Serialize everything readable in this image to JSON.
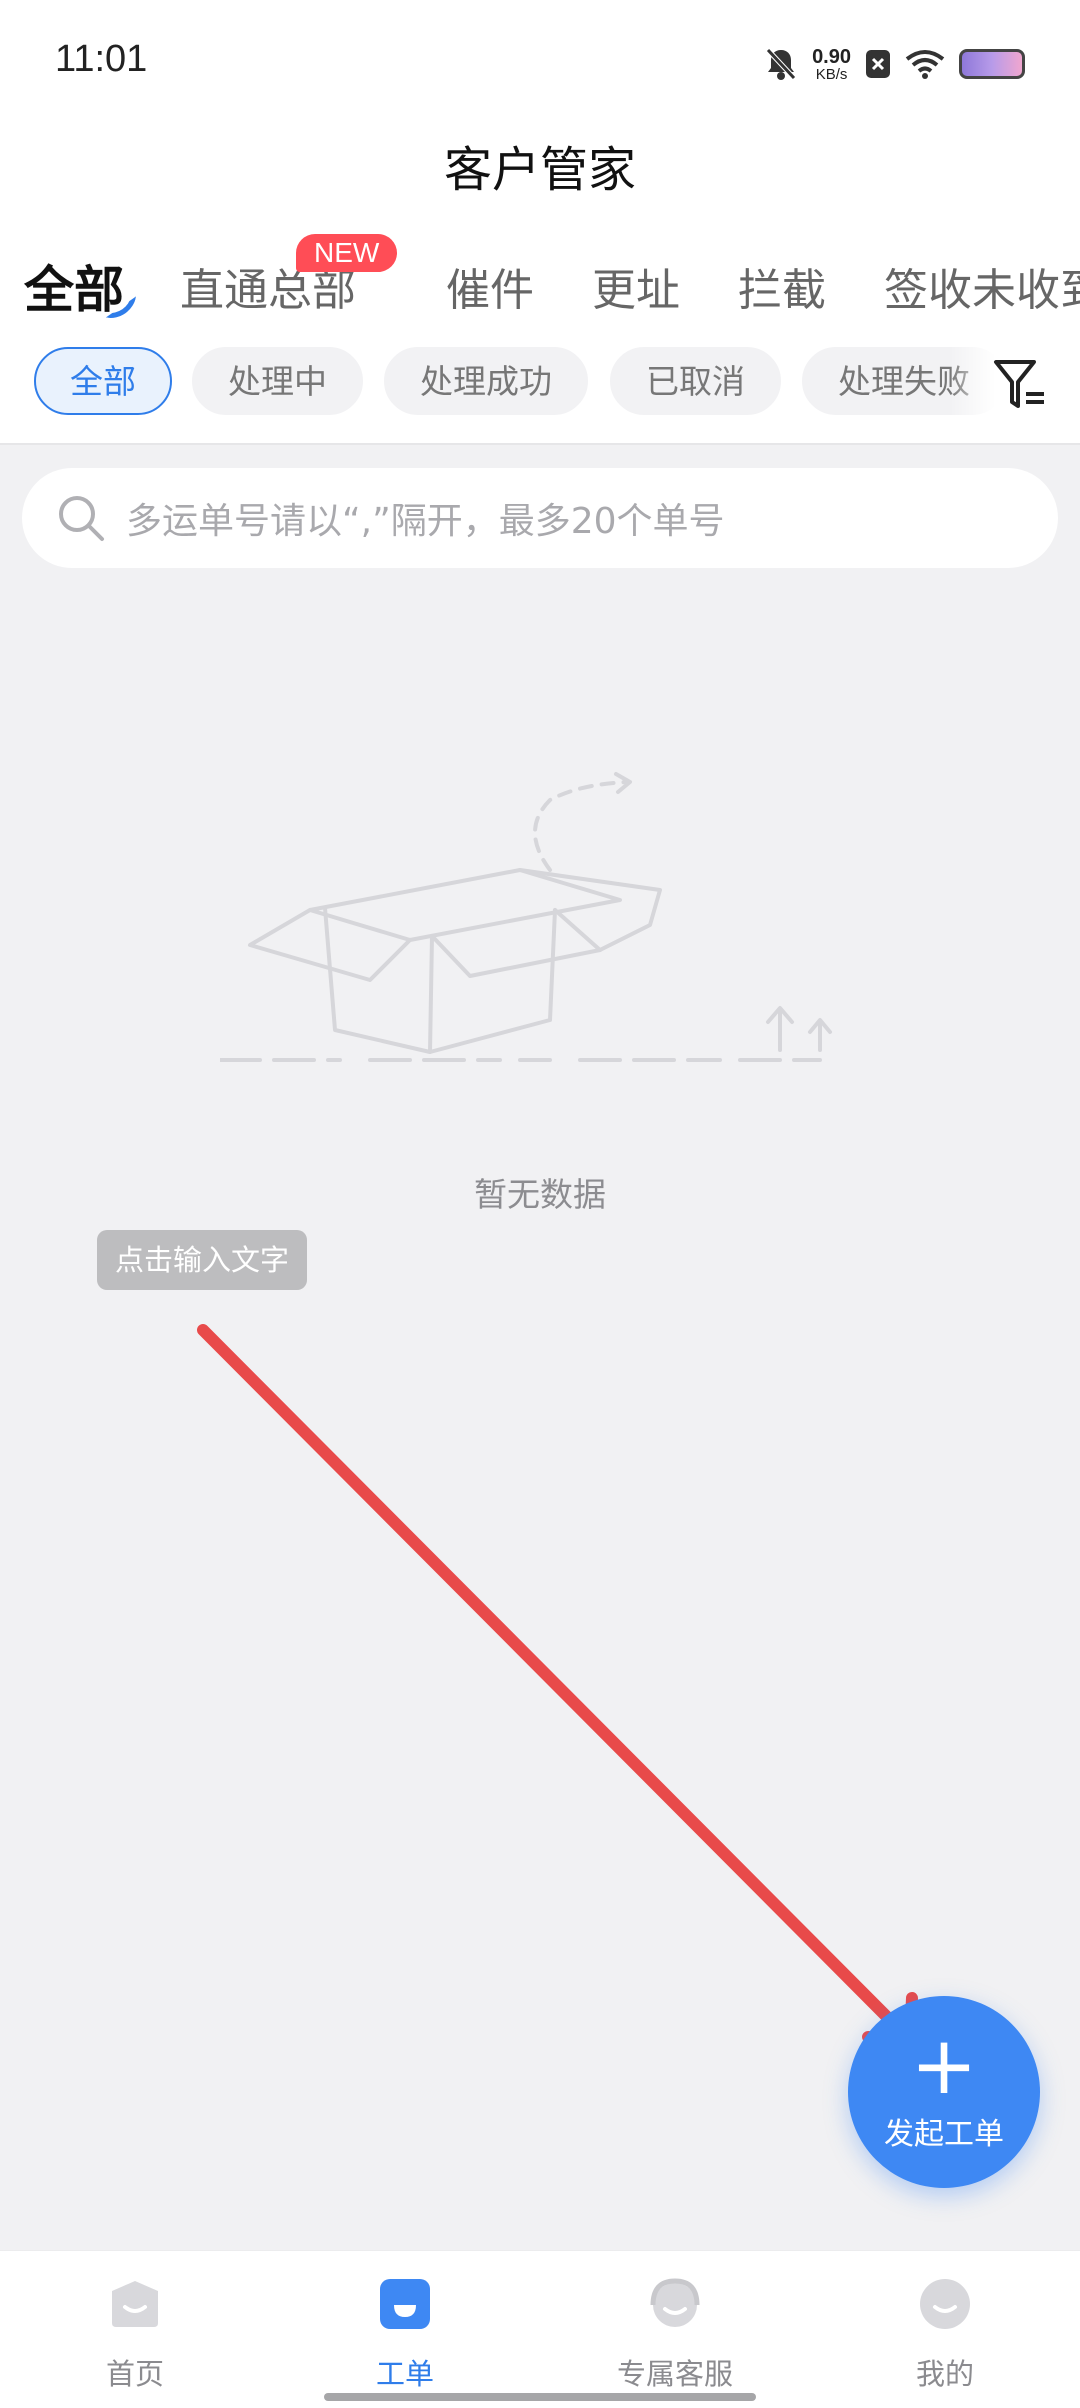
{
  "status_bar": {
    "time": "11:01",
    "net_speed_value": "0.90",
    "net_speed_unit": "KB/s",
    "icons": [
      "mute-bell-icon",
      "close-notification-icon",
      "wifi-icon",
      "battery-icon"
    ]
  },
  "header": {
    "title": "客户管家"
  },
  "main_tabs": {
    "items": [
      {
        "label": "全部",
        "active": true
      },
      {
        "label": "直通总部",
        "badge": "NEW"
      },
      {
        "label": "催件"
      },
      {
        "label": "更址"
      },
      {
        "label": "拦截"
      },
      {
        "label": "签收未收到"
      }
    ]
  },
  "sub_tabs": {
    "items": [
      {
        "label": "全部",
        "active": true
      },
      {
        "label": "处理中"
      },
      {
        "label": "处理成功"
      },
      {
        "label": "已取消"
      },
      {
        "label": "处理失败"
      }
    ],
    "filter_icon": "filter-icon"
  },
  "search": {
    "placeholder": "多运单号请以“,”隔开，最多20个单号"
  },
  "empty_state": {
    "text": "暂无数据",
    "illustration": "empty-box-illustration"
  },
  "annotation": {
    "label": "点击输入文字",
    "arrow_color": "#e84a4a"
  },
  "fab": {
    "label": "发起工单",
    "icon": "plus-icon",
    "color": "#3e88f3"
  },
  "bottom_nav": {
    "items": [
      {
        "label": "首页",
        "icon": "home-icon"
      },
      {
        "label": "工单",
        "icon": "work-order-icon",
        "active": true
      },
      {
        "label": "专属客服",
        "icon": "customer-service-icon"
      },
      {
        "label": "我的",
        "icon": "profile-icon"
      }
    ]
  },
  "colors": {
    "accent": "#2f7dea",
    "badge": "#ff4d56",
    "background": "#f1f1f3"
  }
}
